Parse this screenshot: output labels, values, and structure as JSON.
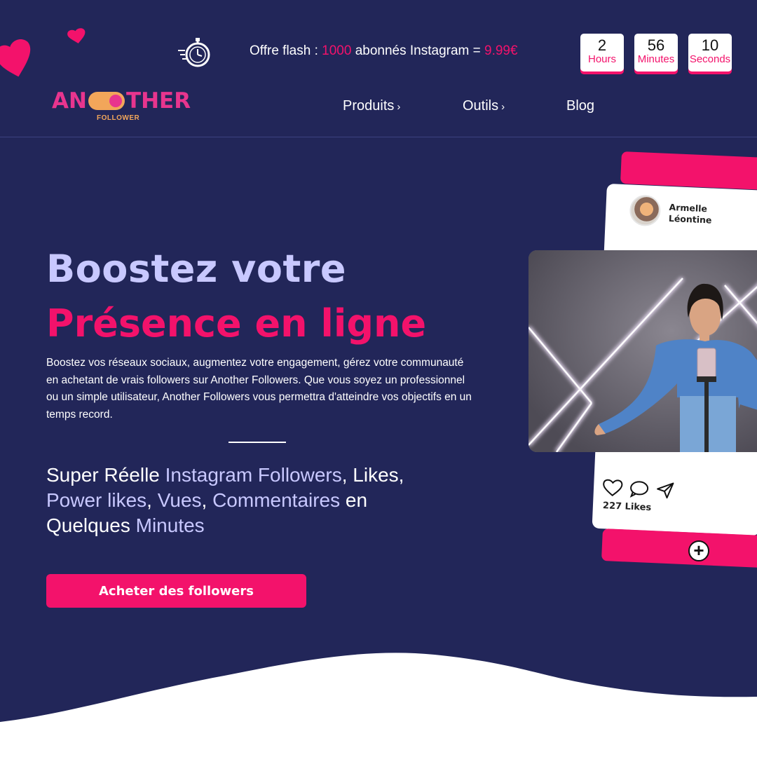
{
  "promo": {
    "prefix": "Offre flash : ",
    "count": "1000",
    "middle": " abonnés Instagram = ",
    "price": "9.99€"
  },
  "countdown": [
    {
      "value": "2",
      "label": "Hours"
    },
    {
      "value": "56",
      "label": "Minutes"
    },
    {
      "value": "10",
      "label": "Seconds"
    }
  ],
  "logo": {
    "part1": "AN",
    "part2": "THER",
    "sub": "FOLLOWER"
  },
  "nav": {
    "produits": "Produits",
    "outils": "Outils",
    "blog": "Blog",
    "chevron": "›"
  },
  "hero": {
    "title_line1": "Boostez votre",
    "title_line2": "Présence en ligne",
    "description": "Boostez vos réseaux sociaux, augmentez votre engagement, gérez votre communauté en achetant de vrais followers sur Another Followers. Que vous soyez un professionnel ou un simple utilisateur, Another Followers vous permettra d'atteindre vos objectifs en un temps record.",
    "tagline": {
      "t1": "Super Réelle ",
      "t2": "Instagram Followers",
      "t3": ", Likes,",
      "t4": "Power likes",
      "t5": ", ",
      "t6": "Vues",
      "t7": ", ",
      "t8": "Commentaires",
      "t9": " en",
      "t10": "Quelques ",
      "t11": "Minutes"
    },
    "cta": "Acheter des followers"
  },
  "mockup": {
    "name_line1": "Armelle",
    "name_line2": "Léontine",
    "likes": "227 Likes",
    "plus": "+"
  },
  "colors": {
    "background": "#222659",
    "accent": "#f3126b",
    "highlight": "#c8c8ff"
  }
}
